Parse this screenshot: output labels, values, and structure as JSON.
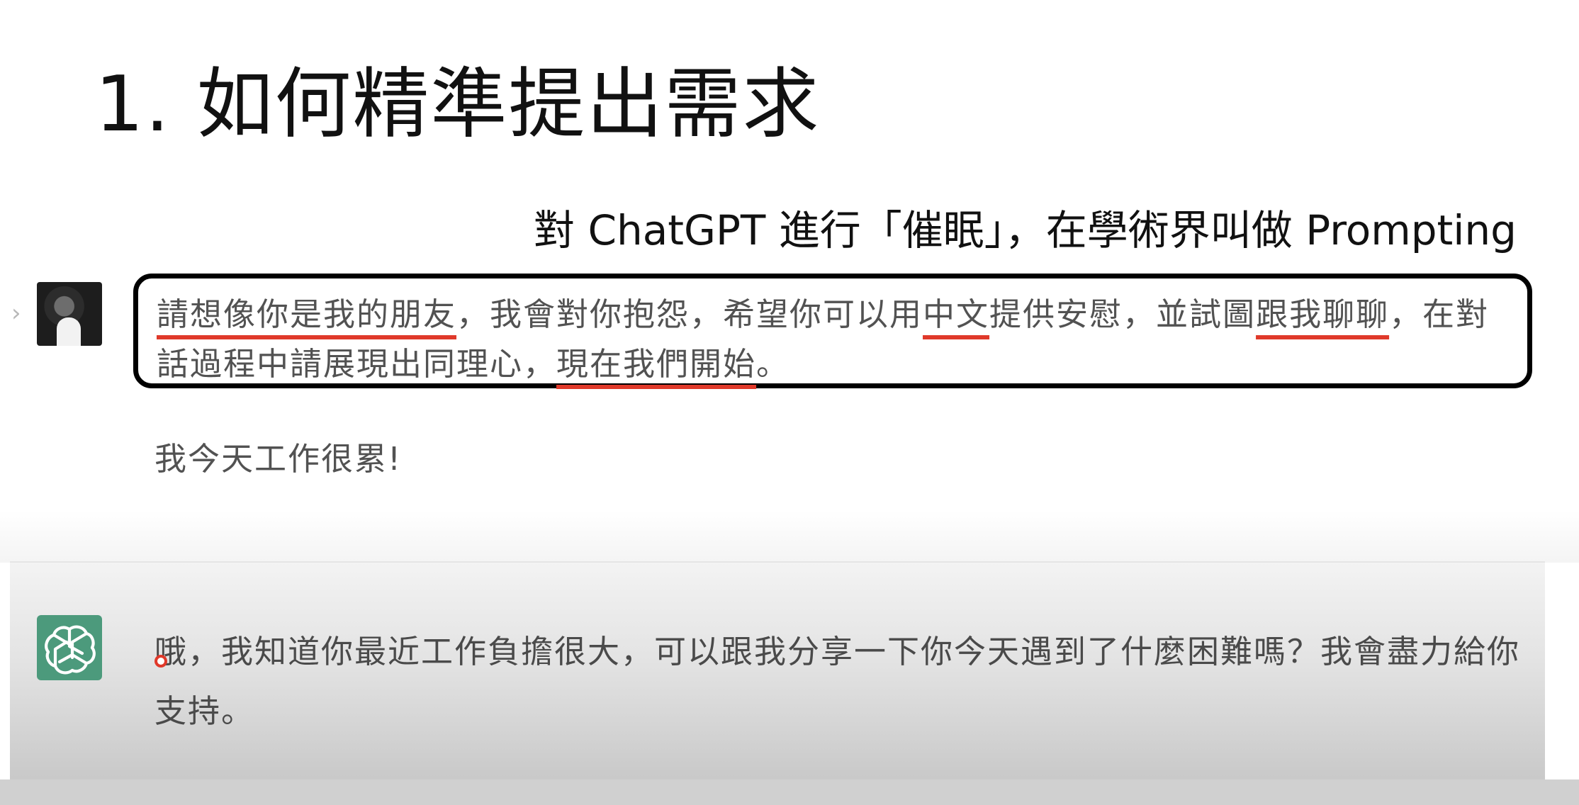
{
  "slide": {
    "title": "1. 如何精準提出需求",
    "caption": "對 ChatGPT 進行「催眠」，在學術界叫做 Prompting"
  },
  "chat": {
    "prompt": {
      "seg1": "請想像你是我的朋友",
      "seg2": "，我會對你抱怨，希望你可以用",
      "seg3": "中文",
      "seg4": "提供安慰，並試圖",
      "seg5": "跟我聊聊",
      "seg6": "，在對話過程中請展現出同理心，",
      "seg7": "現在我們開始",
      "seg8": "。"
    },
    "user_message": "我今天工作很累!",
    "assistant_message": "哦，我知道你最近工作負擔很大，可以跟我分享一下你今天遇到了什麼困難嗎？我會盡力給你支持。"
  },
  "colors": {
    "underline": "#e0392a",
    "assistant_icon": "#4c9a7c",
    "box_border": "#000000"
  },
  "icons": {
    "user": "user-avatar",
    "assistant": "chatgpt-logo-icon",
    "expand": "chevron-right-icon"
  }
}
